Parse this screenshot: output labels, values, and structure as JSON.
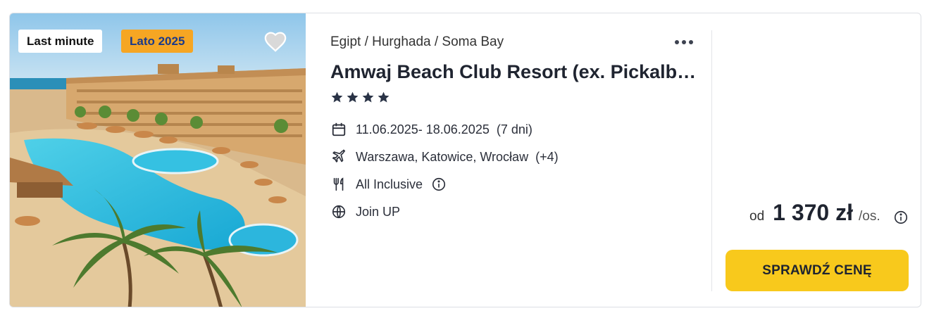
{
  "offer": {
    "badges": {
      "last_minute": "Last minute",
      "season": "Lato 2025"
    },
    "breadcrumb": "Egipt / Hurghada / Soma Bay",
    "hotel_name": "Amwaj Beach Club Resort (ex. Pickalbatros Beach Club Soma Bay)",
    "stars": 4,
    "dates": "11.06.2025- 18.06.2025",
    "duration": "(7 dni)",
    "departure": "Warszawa, Katowice, Wrocław",
    "departure_more": "(+4)",
    "board": "All Inclusive",
    "program": "Join UP",
    "price": {
      "prefix": "od",
      "amount": "1 370 zł",
      "suffix": "/os."
    },
    "cta_label": "SPRAWDŹ CENĘ"
  },
  "icons": {
    "favorite": "heart-icon",
    "more": "more-dots-icon",
    "star": "star-icon",
    "calendar": "calendar-icon",
    "flight": "airplane-icon",
    "board": "cutlery-icon",
    "info": "info-icon",
    "program": "globe-icon"
  },
  "colors": {
    "accent_button": "#f8c91c",
    "season_badge": "#f6a623",
    "season_badge_text": "#1a3a8a",
    "text_primary": "#1f2430"
  }
}
